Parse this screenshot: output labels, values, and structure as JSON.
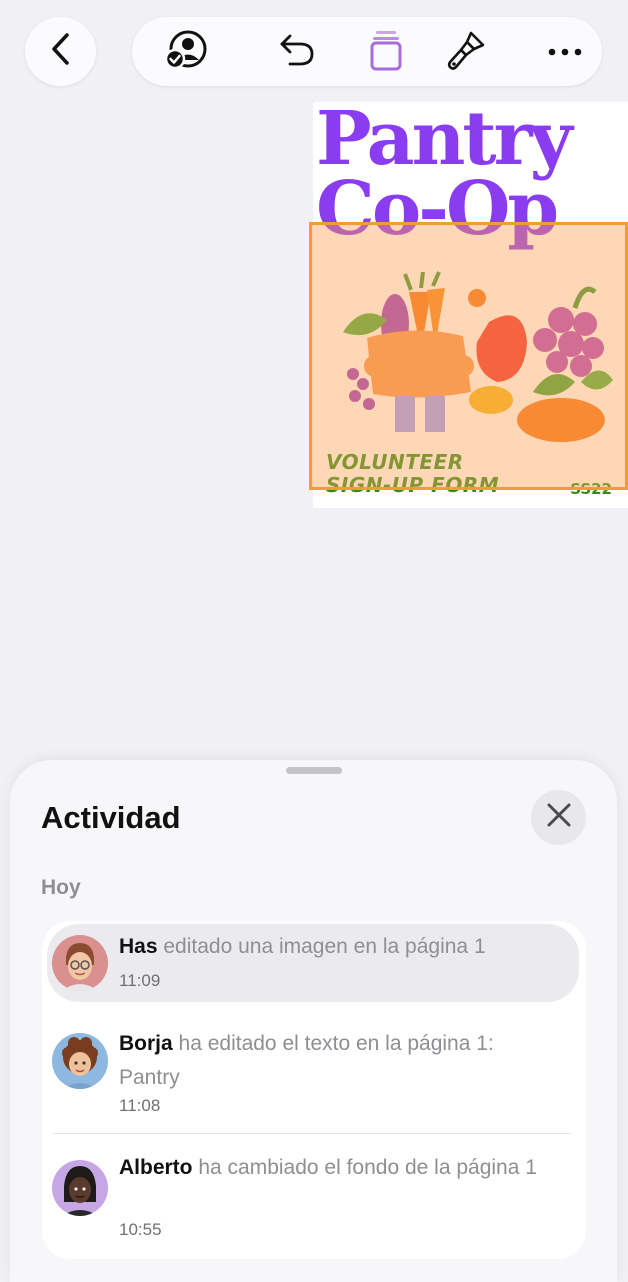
{
  "toolbar": {
    "icons": [
      "chevron-left-icon",
      "collaborate-icon",
      "undo-icon",
      "pages-icon",
      "paintbrush-icon",
      "more-icon"
    ],
    "accent": "#a66bdd"
  },
  "poster": {
    "title_line1": "Pantry",
    "title_line2": "Co-Op",
    "footer_line1": "VOLUNTEER",
    "footer_line2": "SIGN-UP FORM",
    "code": "SS22",
    "title_color": "#8a3cf0",
    "footer_color": "#2b8f1e",
    "selection_color": "#f39a3a"
  },
  "activity": {
    "title": "Actividad",
    "section": "Hoy",
    "items": [
      {
        "who": "Has",
        "action": " editado una imagen en la página 1",
        "time": "11:09"
      },
      {
        "who": "Borja",
        "action": " ha editado el texto en la página 1: Pantry",
        "time": "11:08"
      },
      {
        "who": "Alberto",
        "action": " ha cambiado el fondo de la página 1",
        "time": "10:55"
      }
    ]
  }
}
